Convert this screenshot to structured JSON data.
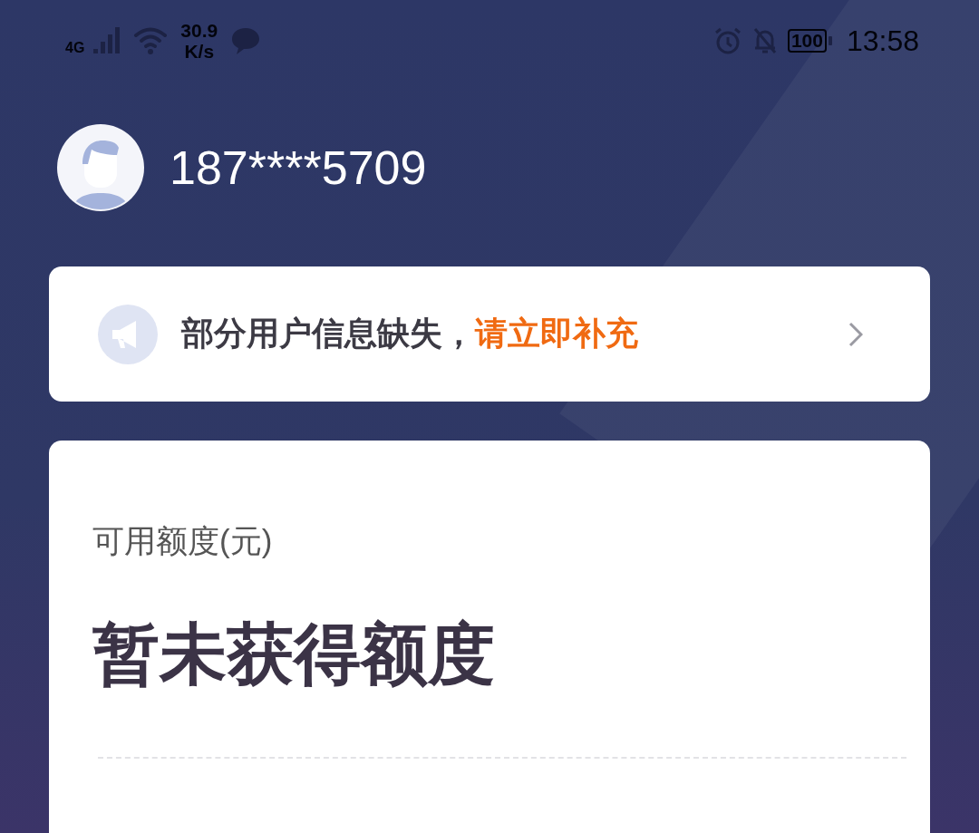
{
  "status_bar": {
    "network": "4G",
    "speed": "30.9",
    "speed_unit": "K/s",
    "battery": "100",
    "time": "13:58"
  },
  "profile": {
    "phone": "187****5709"
  },
  "notice": {
    "message": "部分用户信息缺失，",
    "action": "请立即补充"
  },
  "credit": {
    "label": "可用额度(元)",
    "value": "暂未获得额度"
  }
}
